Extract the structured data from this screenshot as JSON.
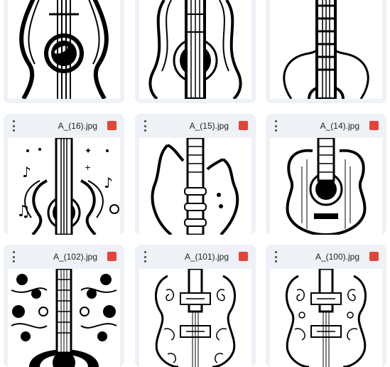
{
  "grid": {
    "files": [
      {
        "name": ""
      },
      {
        "name": ""
      },
      {
        "name": ""
      },
      {
        "name": "A_(16).jpg"
      },
      {
        "name": "A_(15).jpg"
      },
      {
        "name": "A_(14).jpg"
      },
      {
        "name": "A_(102).jpg"
      },
      {
        "name": "A_(101).jpg"
      },
      {
        "name": "A_(100).jpg"
      }
    ]
  },
  "icons": {
    "more": "more-vert-icon",
    "file_type": "image-file-icon",
    "file_type_color": "#e2443a"
  }
}
